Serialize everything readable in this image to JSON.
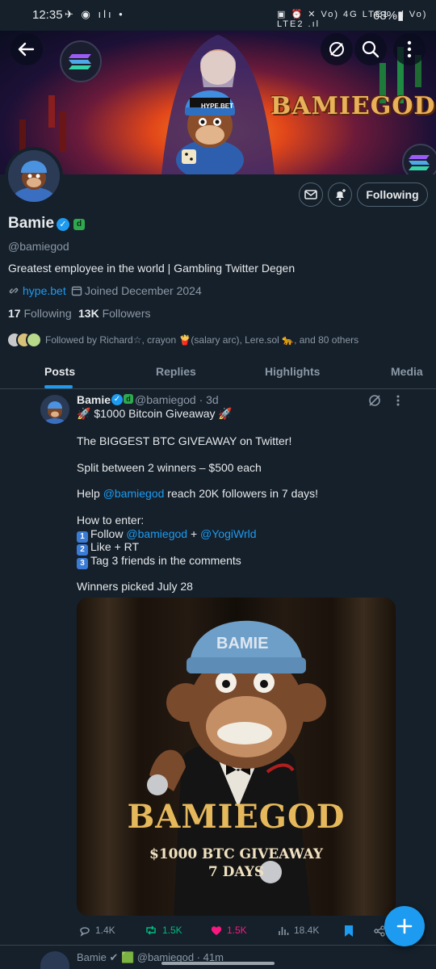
{
  "status_bar": {
    "time": "12:35",
    "left_icons": "✈ ◉ ılı •",
    "right_icons": "▣ ⏰ ✕ Vo) 4G LTE1 .ıl Vo) LTE2 .ıl",
    "battery": "68%▮"
  },
  "banner": {
    "title": "BAMIEGOD",
    "hat_text": "HYPE.BET"
  },
  "profile": {
    "name": "Bamie",
    "affiliate_mark": "d",
    "handle": "@bamiegod",
    "bio": "Greatest employee in the world | Gambling Twitter Degen",
    "website": "hype.bet",
    "joined": "Joined December 2024",
    "following_count": "17",
    "following_label": "Following",
    "followers_count": "13K",
    "followers_label": "Followers",
    "followed_by": "Followed by Richard☆, crayon 🍟(salary arc), Lere.sol 🐆, and 80 others",
    "follow_button": "Following"
  },
  "tabs": [
    "Posts",
    "Replies",
    "Highlights",
    "Media"
  ],
  "post": {
    "author": "Bamie",
    "handle_time": "@bamiegod · 3d",
    "lines": {
      "l1": "🚀 $1000 Bitcoin Giveaway 🚀",
      "l2": "The BIGGEST BTC GIVEAWAY on Twitter!",
      "l3": "Split between 2 winners – $500 each",
      "l4_mention": "@bamiegod",
      "l4_rest": " reach 20K followers in 7 days!",
      "l4_pre": "Help ",
      "l5": "How to enter:",
      "step1_pre": "Follow ",
      "step1_m1": "@bamiegod",
      "step1_plus": " + ",
      "step1_m2": "@YogiWrld",
      "step2": "Like + RT",
      "step3": "Tag 3 friends in the comments",
      "winners": "Winners picked July 28",
      "k1": "1",
      "k2": "2",
      "k3": "3"
    },
    "image": {
      "hat_text": "BAMIE",
      "title": "BAMIEGOD",
      "subtitle": "$1000 BTC GIVEAWAY",
      "subtitle2": "7 DAYS"
    },
    "replies": "1.4K",
    "reposts": "1.5K",
    "likes": "1.5K",
    "views": "18.4K"
  },
  "next_post": "Bamie ✔ 🟩 @bamiegod · 41m",
  "colors": {
    "accent": "#1d9bf0",
    "background": "#15202b",
    "like": "#f91880",
    "repost": "#00ba7c"
  }
}
